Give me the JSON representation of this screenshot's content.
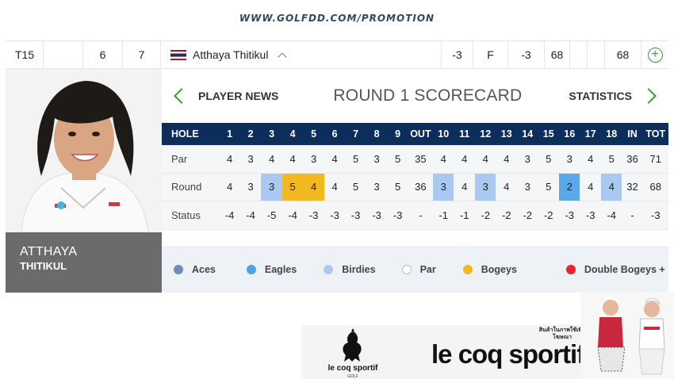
{
  "promo": {
    "url": "WWW.GOLFDD.COM/PROMOTION"
  },
  "leaderboard_row": {
    "position": "T15",
    "col_a": "6",
    "col_b": "7",
    "player_name": "Atthaya Thitikul",
    "to_par": "-3",
    "thru": "F",
    "today": "-3",
    "r1": "68",
    "total": "68"
  },
  "player": {
    "first_name": "ATTHAYA",
    "last_name": "THITIKUL"
  },
  "nav": {
    "player_news": "PLAYER NEWS",
    "title": "ROUND 1 SCORECARD",
    "statistics": "STATISTICS"
  },
  "scorecard": {
    "columns": [
      "HOLE",
      "1",
      "2",
      "3",
      "4",
      "5",
      "6",
      "7",
      "8",
      "9",
      "OUT",
      "10",
      "11",
      "12",
      "13",
      "14",
      "15",
      "16",
      "17",
      "18",
      "IN",
      "TOT"
    ],
    "rows": [
      {
        "label": "Par",
        "cells": [
          "4",
          "3",
          "4",
          "4",
          "3",
          "4",
          "5",
          "3",
          "5",
          "35",
          "4",
          "4",
          "4",
          "4",
          "3",
          "5",
          "3",
          "4",
          "5",
          "36",
          "71"
        ]
      },
      {
        "label": "Round",
        "cells": [
          "4",
          "3",
          "3",
          "5",
          "4",
          "4",
          "5",
          "3",
          "5",
          "36",
          "3",
          "4",
          "3",
          "4",
          "3",
          "5",
          "2",
          "4",
          "4",
          "32",
          "68"
        ]
      },
      {
        "label": "Status",
        "cells": [
          "-4",
          "-4",
          "-5",
          "-4",
          "-3",
          "-3",
          "-3",
          "-3",
          "-3",
          "-",
          "-1",
          "-1",
          "-2",
          "-2",
          "-2",
          "-2",
          "-3",
          "-3",
          "-4",
          "-",
          "-3"
        ]
      }
    ],
    "round_highlights": [
      "",
      "",
      "birdie",
      "bogey",
      "bogey",
      "",
      "",
      "",
      "",
      "",
      "birdie",
      "",
      "birdie",
      "",
      "",
      "",
      "eagle",
      "",
      "birdie",
      "",
      ""
    ]
  },
  "legend": [
    {
      "label": "Aces",
      "color": "#6e8fb5"
    },
    {
      "label": "Eagles",
      "color": "#4aa3e6"
    },
    {
      "label": "Birdies",
      "color": "#a9c9f0"
    },
    {
      "label": "Par",
      "color": "#ffffff"
    },
    {
      "label": "Bogeys",
      "color": "#f2b81f"
    },
    {
      "label": "Double Bogeys +",
      "color": "#e8262b"
    }
  ],
  "ad": {
    "brand_small": "le coq sportif",
    "brand_small_sub": "GOLF",
    "brand_large": "le coq sportif",
    "tagline": "สินค้าในภาพใช้เพื่อโฆษณา"
  }
}
